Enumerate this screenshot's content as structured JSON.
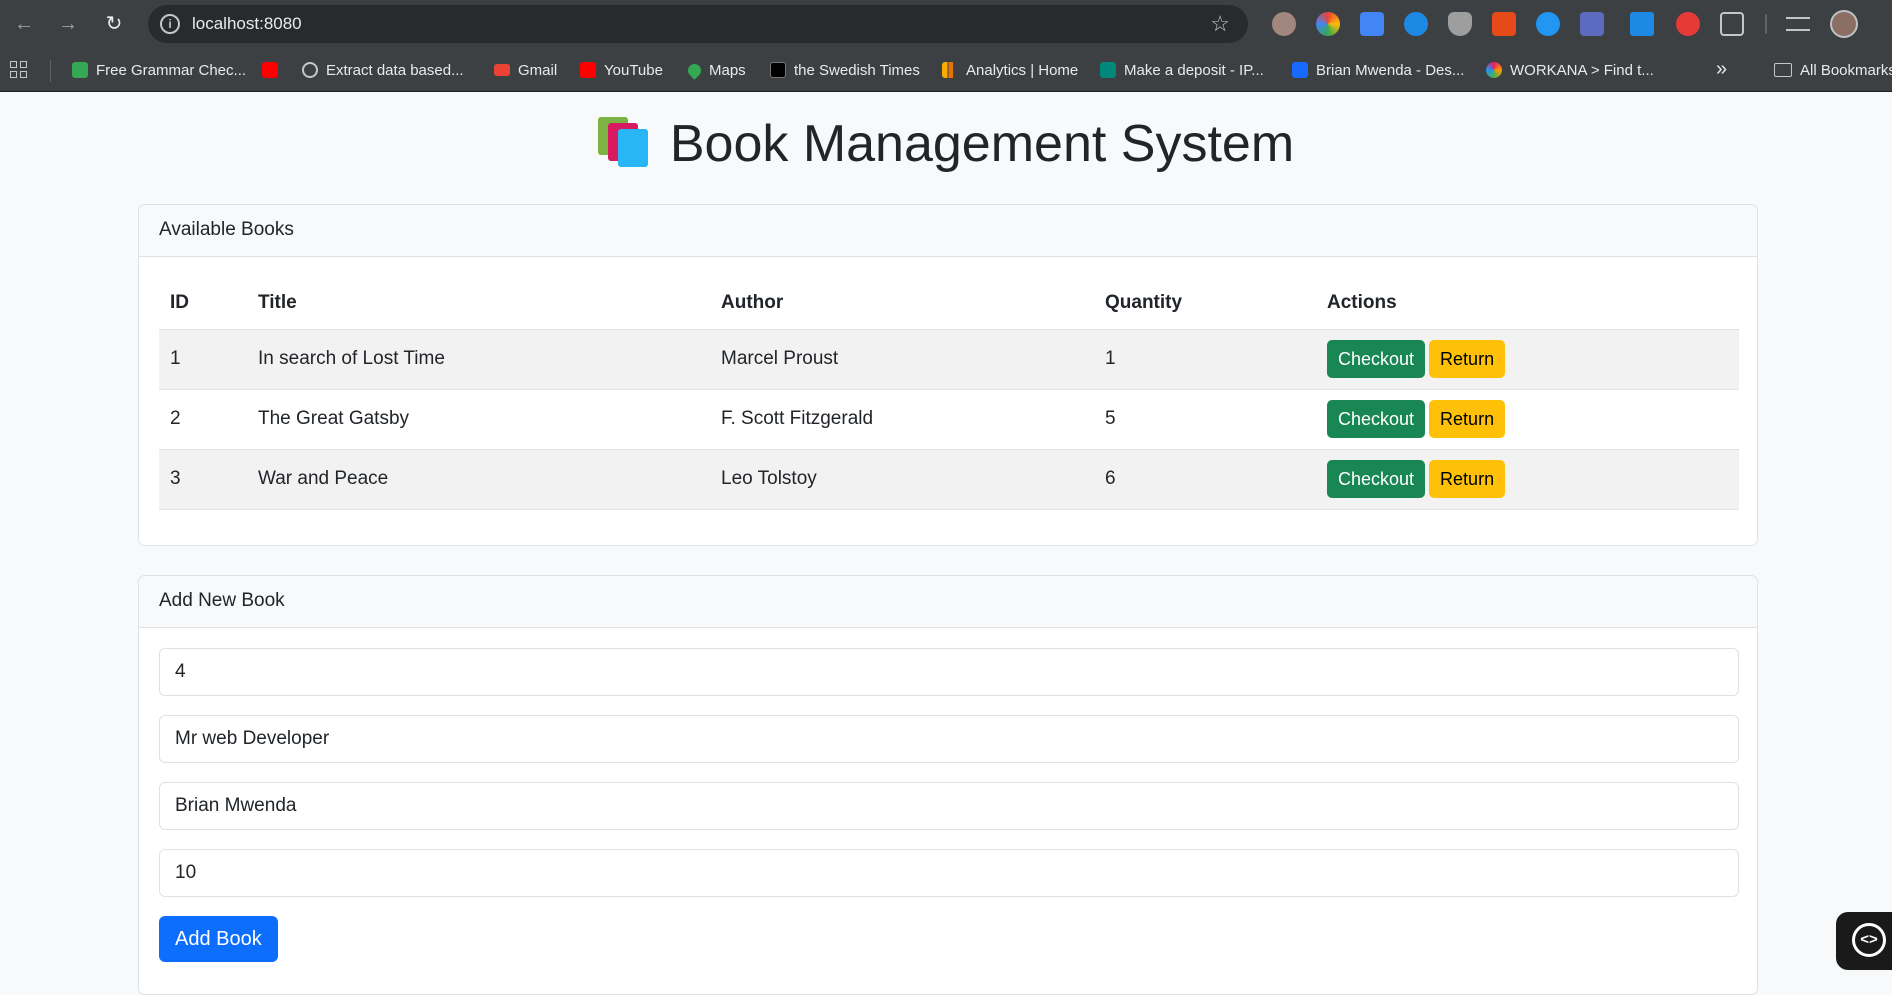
{
  "browser": {
    "url": "localhost:8080",
    "bookmarks": [
      {
        "label": "Free Grammar Chec...",
        "color": "#34a853"
      },
      {
        "label": "",
        "color": "#ff0000"
      },
      {
        "label": "Extract data based...",
        "color": "#9aa0a6"
      },
      {
        "label": "Gmail",
        "color": "#ea4335"
      },
      {
        "label": "YouTube",
        "color": "#ff0000"
      },
      {
        "label": "Maps",
        "color": "#34a853"
      },
      {
        "label": "the Swedish Times",
        "color": "#000000"
      },
      {
        "label": "Analytics | Home",
        "color": "#f9ab00"
      },
      {
        "label": "Make a deposit - IP...",
        "color": "#00897b"
      },
      {
        "label": "Brian Mwenda - Des...",
        "color": "#1769ff"
      },
      {
        "label": "WORKANA > Find t...",
        "color": "#e91e63"
      }
    ],
    "all_bookmarks_label": "All Bookmarks"
  },
  "page": {
    "title": "Book Management System",
    "available_books": {
      "header": "Available Books",
      "columns": [
        "ID",
        "Title",
        "Author",
        "Quantity",
        "Actions"
      ],
      "rows": [
        {
          "id": "1",
          "title": "In search of Lost Time",
          "author": "Marcel Proust",
          "quantity": "1"
        },
        {
          "id": "2",
          "title": "The Great Gatsby",
          "author": "F. Scott Fitzgerald",
          "quantity": "5"
        },
        {
          "id": "3",
          "title": "War and Peace",
          "author": "Leo Tolstoy",
          "quantity": "6"
        }
      ],
      "checkout_label": "Checkout",
      "return_label": "Return"
    },
    "add_book": {
      "header": "Add New Book",
      "fields": {
        "id": "4",
        "title": "Mr web Developer",
        "author": "Brian Mwenda",
        "quantity": "10"
      },
      "submit_label": "Add Book"
    }
  }
}
